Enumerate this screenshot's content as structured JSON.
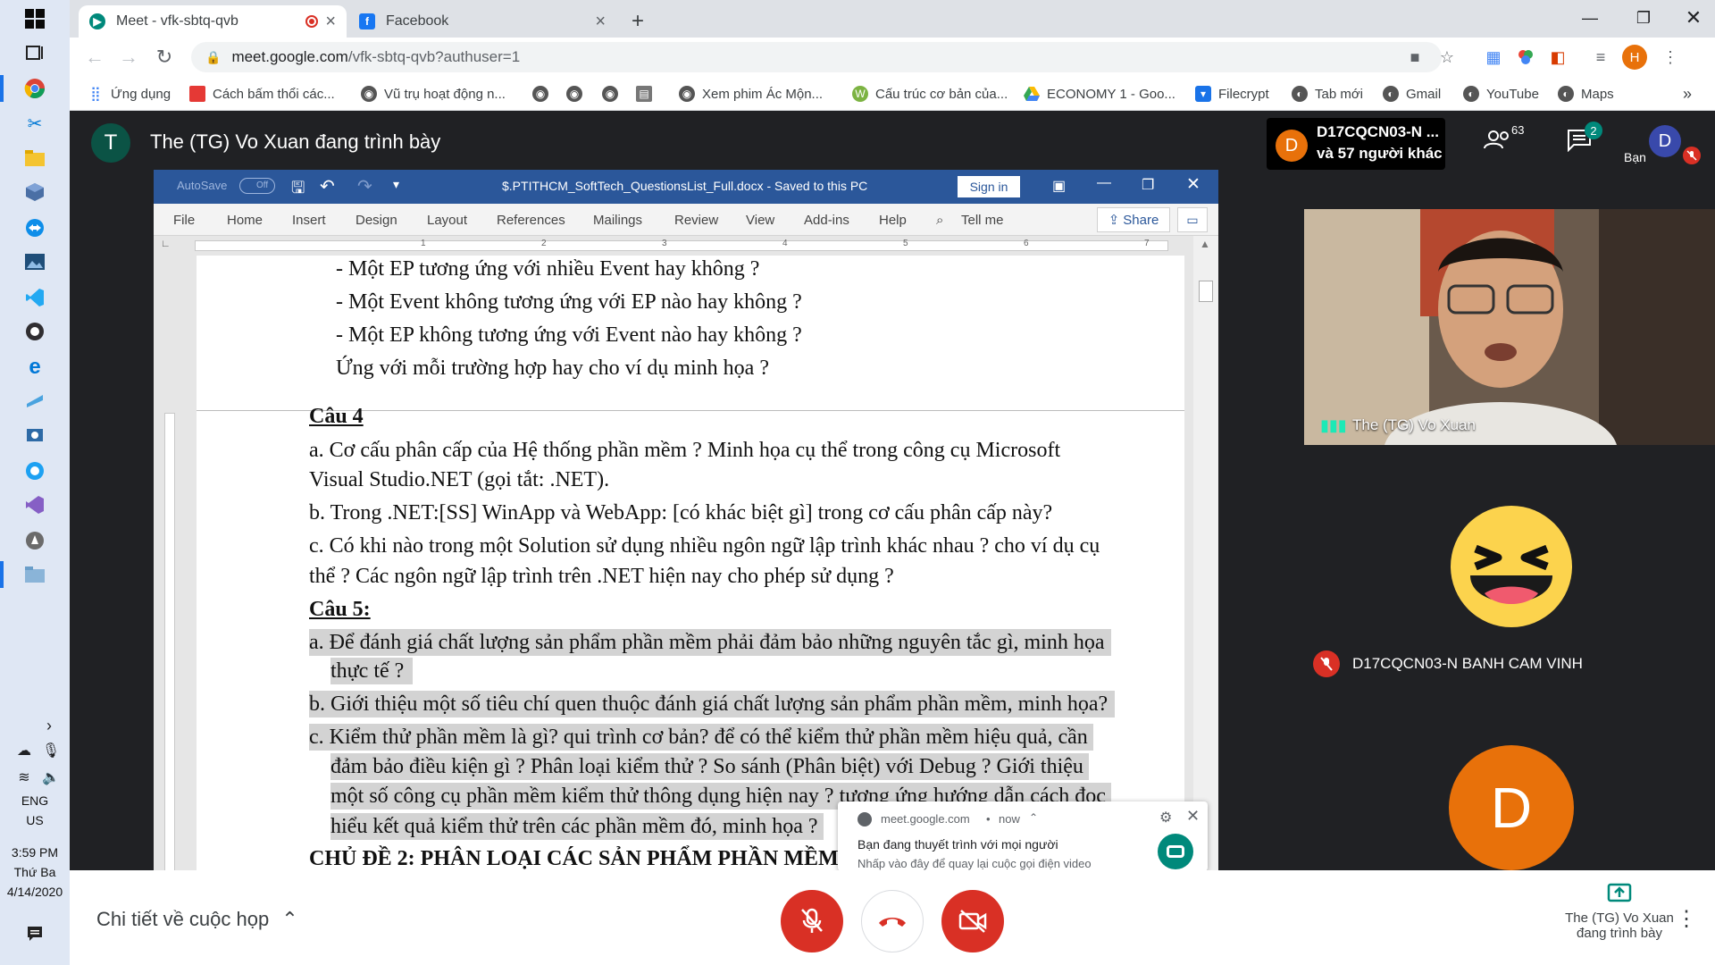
{
  "taskbar": {
    "time": "3:59 PM",
    "day": "Thứ Ba",
    "date": "4/14/2020",
    "lang_1": "ENG",
    "lang_2": "US",
    "pinned_apps": [
      "windows-start-icon",
      "task-view-icon",
      "chrome-icon",
      "snipping-icon",
      "file-explorer-icon",
      "box-icon",
      "teamviewer-icon",
      "photos-icon",
      "vscode-icon",
      "obs-icon",
      "edge-icon",
      "sketch-icon",
      "network-icon",
      "browser-icon",
      "visual-studio-icon",
      "bootcamp-icon",
      "folder-icon"
    ]
  },
  "chrome": {
    "tabs": [
      {
        "title": "Meet - vfk-sbtq-qvb",
        "active": true,
        "icon": "meet-icon",
        "recording": true
      },
      {
        "title": "Facebook",
        "active": false,
        "icon": "facebook-icon"
      }
    ],
    "new_tab": "+",
    "url_host": "meet.google.com",
    "url_path": "/vfk-sbtq-qvb?authuser=1",
    "profile_initial": "H",
    "bookmarks": [
      {
        "label": "Ứng dụng",
        "icon": "apps-grid-icon"
      },
      {
        "label": "Cách bấm thổi các...",
        "icon": "bookmark-icon"
      },
      {
        "label": "Vũ trụ hoạt động n...",
        "icon": "bookmark-icon"
      },
      {
        "label": "",
        "icon": "bookmark-icon"
      },
      {
        "label": "",
        "icon": "bookmark-icon"
      },
      {
        "label": "",
        "icon": "bookmark-icon"
      },
      {
        "label": "",
        "icon": "bookmark-icon"
      },
      {
        "label": "Xem phim Ác Mộn...",
        "icon": "bookmark-icon"
      },
      {
        "label": "Cấu trúc cơ bản của...",
        "icon": "bookmark-icon"
      },
      {
        "label": "ECONOMY 1 - Goo...",
        "icon": "drive-icon"
      },
      {
        "label": "Filecrypt",
        "icon": "shield-icon"
      },
      {
        "label": "Tab mới",
        "icon": "globe-icon"
      },
      {
        "label": "Gmail",
        "icon": "globe-icon"
      },
      {
        "label": "YouTube",
        "icon": "globe-icon"
      },
      {
        "label": "Maps",
        "icon": "globe-icon"
      }
    ],
    "bookmarks_more": "»"
  },
  "meet": {
    "presenter_initial": "T",
    "presenter_title": "The (TG) Vo Xuan đang trình bày",
    "chip_initial": "D",
    "chip_line1": "D17CQCN03-N ...",
    "chip_line2": "và 57 người khác",
    "people_count": "63",
    "chat_count": "2",
    "self_initial": "D",
    "self_label": "Bạn",
    "video_label": "The (TG) Vo Xuan",
    "participant_name": "D17CQCN03-N BANH CAM VINH",
    "avatar_initial": "D",
    "meeting_details": "Chi tiết về cuộc họp",
    "presenting_line1": "The (TG) Vo Xuan",
    "presenting_line2": "đang trình bày",
    "notification": {
      "source": "meet.google.com",
      "time": "now",
      "title": "Bạn đang thuyết trình với mọi người",
      "body": "Nhấp vào đây để quay lại cuộc gọi điện video"
    }
  },
  "word": {
    "autosave": "AutoSave",
    "autosave_state": "Off",
    "doc_title": "$.PTITHCM_SoftTech_QuestionsList_Full.docx  -  Saved to this PC",
    "sign_in": "Sign in",
    "ribbon_tabs": [
      "File",
      "Home",
      "Insert",
      "Design",
      "Layout",
      "References",
      "Mailings",
      "Review",
      "View",
      "Add-ins",
      "Help"
    ],
    "tell_me": "Tell me",
    "share": "Share",
    "ruler_numbers": [
      "1",
      "2",
      "3",
      "4",
      "5",
      "6",
      "7"
    ],
    "lines": [
      {
        "text": "- Một EP tương ứng với nhiều Event hay không ?"
      },
      {
        "text": "- Một Event không tương ứng với EP nào hay không ?"
      },
      {
        "text": "- Một EP không tương ứng với Event nào hay không ?"
      },
      {
        "text": "Ứng với mỗi trường hợp hay cho ví dụ minh họa ?"
      },
      {
        "text": "Câu 4"
      },
      {
        "text": "a.  Cơ cấu phân cấp của Hệ thống phần mềm ? Minh họa cụ thể trong công cụ Microsoft"
      },
      {
        "text": "Visual Studio.NET (gọi tắt: .NET)."
      },
      {
        "text": "b.  Trong .NET:[SS] WinApp và WebApp: [có khác biệt gì] trong cơ cấu phân cấp này?"
      },
      {
        "text": "c.  Có khi nào trong một Solution sử dụng nhiều ngôn ngữ lập trình khác nhau ? cho ví dụ cụ"
      },
      {
        "text": "thể ? Các ngôn ngữ lập trình trên .NET hiện nay cho phép sử dụng ?"
      },
      {
        "text": "Câu 5:"
      },
      {
        "text": "a.  Để đánh giá chất lượng sản phẩm phần mềm phải đảm bảo những nguyên tắc gì, minh họa"
      },
      {
        "text": "thực tế ?"
      },
      {
        "text": "b.  Giới thiệu một số tiêu chí quen thuộc đánh giá chất lượng sản phẩm phần mềm, minh họa?"
      },
      {
        "text": "c.  Kiểm thử phần mềm là gì? qui trình cơ bản? để có thể kiểm thử phần mềm hiệu quả, cần"
      },
      {
        "text": "đảm bảo điều kiện gì ? Phân loại kiểm thử ? So sánh (Phân biệt) với Debug ? Giới thiệu"
      },
      {
        "text": "một số công cụ phần mềm kiểm thử thông dụng hiện nay ? tương ứng hướng dẫn cách đọc"
      },
      {
        "text": "hiểu kết quả kiểm thử trên các phần mềm đó, minh họa ?"
      },
      {
        "text": "CHỦ ĐỀ 2: PHÂN LOẠI CÁC SẢN PHẨM PHẦN MỀM"
      }
    ]
  },
  "colors": {
    "word_blue": "#2b579a",
    "meet_dark": "#202124",
    "end_call_red": "#d93025",
    "avatar_orange": "#e8710a",
    "emoji_yellow": "#fcd34d"
  }
}
